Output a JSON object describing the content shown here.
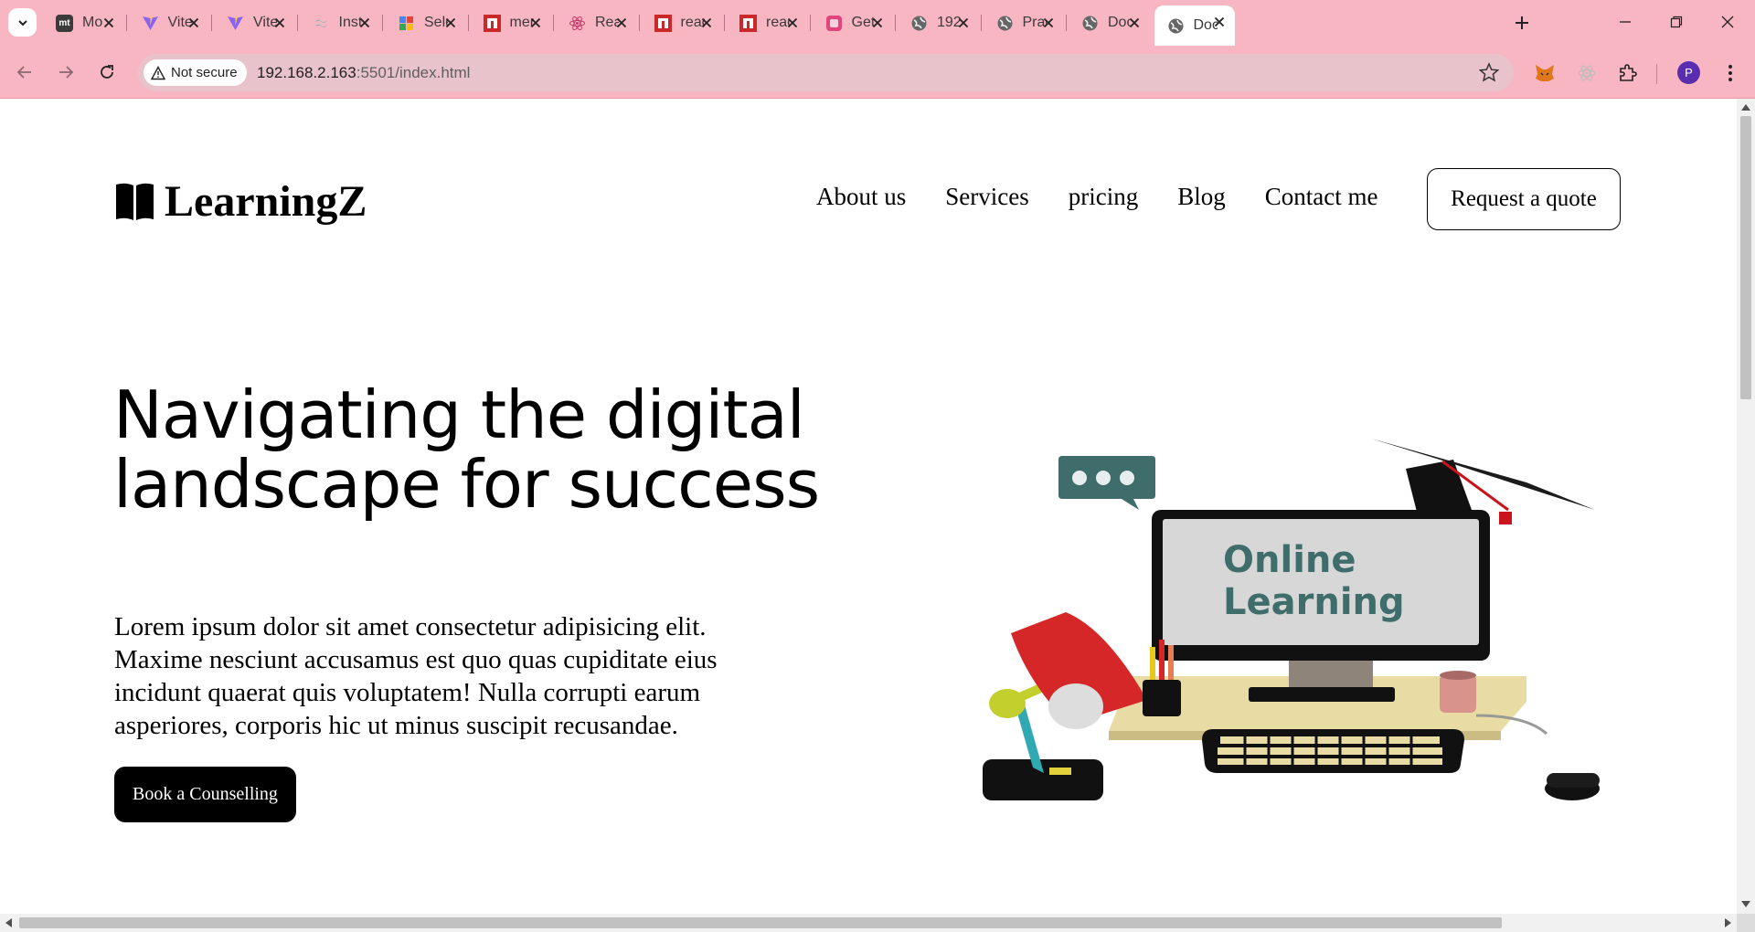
{
  "browser": {
    "tabs": [
      {
        "title": "Mo",
        "favicon": "mt-icon",
        "color": "#3b3b3b"
      },
      {
        "title": "Vite",
        "favicon": "vite-icon",
        "color": "#8a63f5"
      },
      {
        "title": "Vite",
        "favicon": "vite-icon",
        "color": "#8a63f5"
      },
      {
        "title": "Inst",
        "favicon": "tailwind-icon",
        "color": "#38b2ac"
      },
      {
        "title": "Sele",
        "favicon": "google-icon",
        "color": "#4285f4"
      },
      {
        "title": "mer",
        "favicon": "npm-icon",
        "color": "#cb2929"
      },
      {
        "title": "Rea",
        "favicon": "react-icon",
        "color": "#c63b6a"
      },
      {
        "title": "reac",
        "favicon": "npm-icon",
        "color": "#cb2929"
      },
      {
        "title": "reac",
        "favicon": "npm-icon",
        "color": "#cb2929"
      },
      {
        "title": "Get",
        "favicon": "app-icon",
        "color": "#e0457b"
      },
      {
        "title": "192",
        "favicon": "globe-icon",
        "color": "#555555"
      },
      {
        "title": "Prac",
        "favicon": "globe-icon",
        "color": "#555555"
      },
      {
        "title": "Doc",
        "favicon": "globe-icon",
        "color": "#555555"
      },
      {
        "title": "Doc",
        "favicon": "globe-icon",
        "color": "#555555"
      }
    ],
    "security_label": "Not secure",
    "url_host": "192.168.2.163",
    "url_path": ":5501/index.html",
    "profile_initial": "P"
  },
  "site": {
    "logo": "LearningZ",
    "nav": [
      "About us",
      "Services",
      "pricing",
      "Blog",
      "Contact me"
    ],
    "cta": "Request a quote",
    "hero": {
      "title": "Navigating the digital landscape for success",
      "text": "Lorem ipsum dolor sit amet consectetur adipisicing elit. Maxime nesciunt accusamus est quo quas cupiditate eius incidunt quaerat quis voluptatem! Nulla corrupti earum asperiores, corporis hic ut minus suscipit recusandae.",
      "button": "Book a Counselling"
    },
    "illustration": {
      "screen_line1": "Online",
      "screen_line2": "Learning"
    }
  },
  "colors": {
    "chrome": "#f7b6c2",
    "omnibox": "#e9c3cb",
    "screen_text": "#3f6d6b"
  }
}
